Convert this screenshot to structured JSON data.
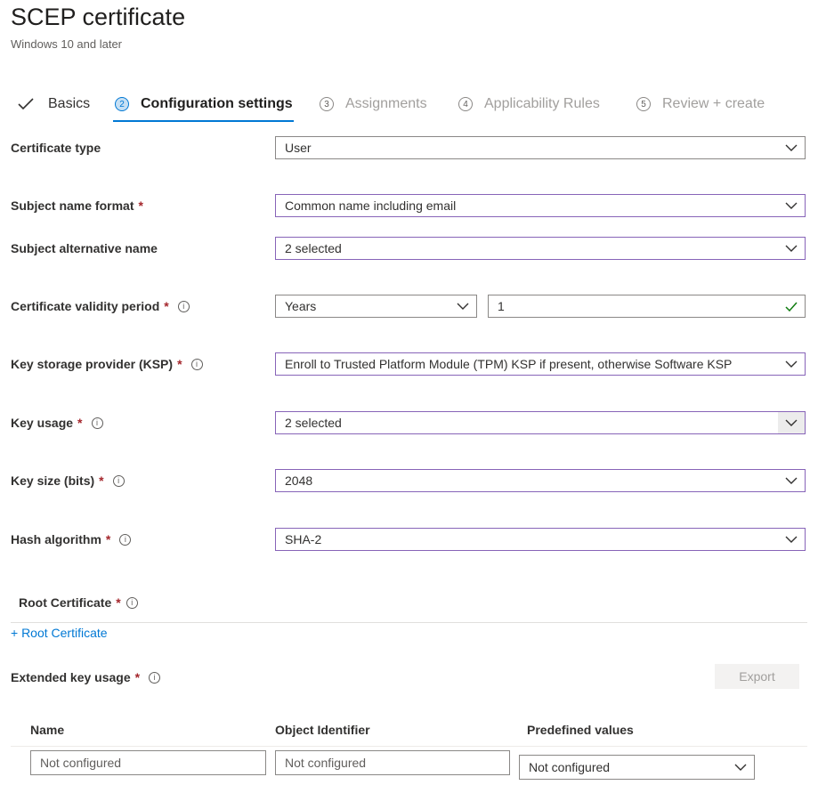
{
  "header": {
    "title": "SCEP certificate",
    "subtitle": "Windows 10 and later"
  },
  "steps": [
    {
      "number": "",
      "label": "Basics",
      "state": "done"
    },
    {
      "number": "2",
      "label": "Configuration settings",
      "state": "active"
    },
    {
      "number": "3",
      "label": "Assignments",
      "state": "disabled"
    },
    {
      "number": "4",
      "label": "Applicability Rules",
      "state": "disabled"
    },
    {
      "number": "5",
      "label": "Review + create",
      "state": "disabled"
    }
  ],
  "form": {
    "certificate_type": {
      "label": "Certificate type",
      "value": "User"
    },
    "subject_name_format": {
      "label": "Subject name format",
      "required": "*",
      "value": "Common name including email"
    },
    "subject_alternative_name": {
      "label": "Subject alternative name",
      "value": "2 selected"
    },
    "certificate_validity_period": {
      "label": "Certificate validity period",
      "required": "*",
      "unit_value": "Years",
      "number_value": "1"
    },
    "key_storage_provider": {
      "label": "Key storage provider (KSP)",
      "required": "*",
      "value": "Enroll to Trusted Platform Module (TPM) KSP if present, otherwise Software KSP"
    },
    "key_usage": {
      "label": "Key usage",
      "required": "*",
      "value": "2 selected"
    },
    "key_size": {
      "label": "Key size (bits)",
      "required": "*",
      "value": "2048"
    },
    "hash_algorithm": {
      "label": "Hash algorithm",
      "required": "*",
      "value": "SHA-2"
    }
  },
  "root_certificate": {
    "label": "Root Certificate",
    "required": "*",
    "add_link": "+ Root Certificate"
  },
  "extended_key_usage": {
    "label": "Extended key usage",
    "required": "*",
    "export_label": "Export",
    "columns": [
      "Name",
      "Object Identifier",
      "Predefined values"
    ],
    "row": {
      "name_placeholder": "Not configured",
      "oid_placeholder": "Not configured",
      "predefined_value": "Not configured"
    }
  },
  "info_glyph": "i",
  "colors": {
    "accent": "#0078d4",
    "required": "#a4262c",
    "focus_border": "#8764b8",
    "valid_check": "#107c10"
  },
  "icons": {
    "check": "checkmark-icon",
    "chevron": "chevron-down-icon",
    "info": "info-icon"
  }
}
